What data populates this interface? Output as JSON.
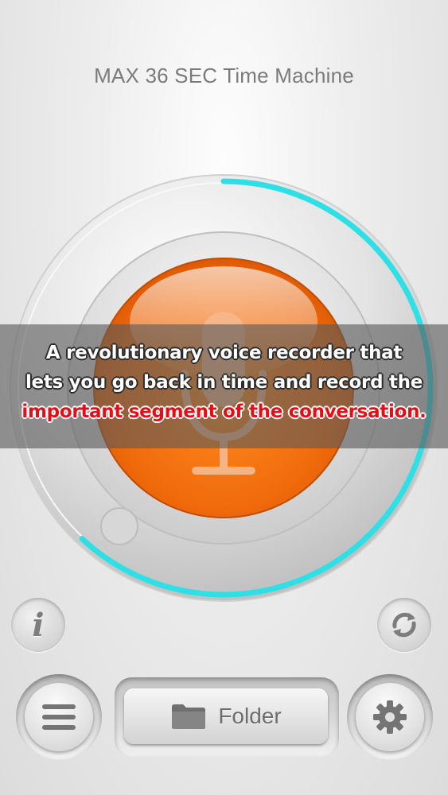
{
  "header": {
    "title": "MAX 36  SEC Time Machine"
  },
  "recorder": {
    "progress_fraction": 0.62,
    "ring_color": "#2ee0e6",
    "record_button_color": "#f26b0f",
    "record_icon": "microphone-icon"
  },
  "caption": {
    "line1": "A revolutionary voice recorder that",
    "line2": "lets you go back in time and record the",
    "line3": "important segment of the conversation.",
    "highlight_color": "#e30f16"
  },
  "controls": {
    "info_icon": "info-icon",
    "info_glyph": "i",
    "sync_icon": "sync-icon",
    "menu_icon": "menu-icon",
    "settings_icon": "gear-icon",
    "folder_icon": "folder-icon",
    "folder_label": "Folder"
  }
}
